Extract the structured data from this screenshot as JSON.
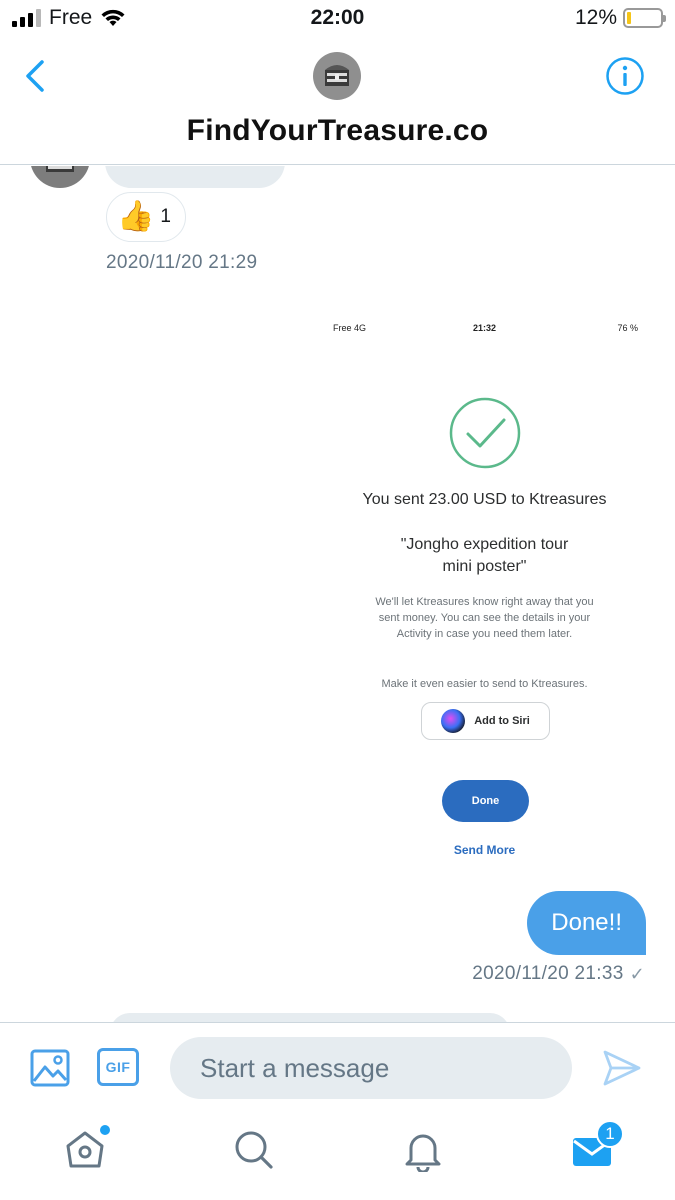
{
  "status_bar": {
    "carrier": "Free",
    "time": "22:00",
    "battery": "12%",
    "battery_level": 0.12
  },
  "header": {
    "title": "FindYourTreasure.co",
    "back_icon": "chevron-left-icon",
    "info_icon": "info-icon"
  },
  "messages": {
    "reaction_emoji": "👍",
    "reaction_count": "1",
    "timestamp_incoming": "2020/11/20 21:29",
    "outgoing_text": "Done!!",
    "timestamp_outgoing": "2020/11/20 21:33",
    "read_mark": "✓"
  },
  "receipt": {
    "status_left": "Free  4G",
    "status_time": "21:32",
    "status_right": "76 %",
    "sent_line": "You sent 23.00 USD to Ktreasures",
    "note_line1": "\"Jongho expedition tour",
    "note_line2": "mini poster\"",
    "body_line1": "We'll let Ktreasures know right away that you",
    "body_line2": "sent money. You can see the details in your",
    "body_line3": "Activity in case you need them later.",
    "easier_line": "Make it even easier to send to Ktreasures.",
    "siri_button": "Add to Siri",
    "done_button": "Done",
    "send_more": "Send More"
  },
  "composer": {
    "placeholder": "Start a message",
    "gif_label": "GIF",
    "image_icon": "image-icon",
    "send_icon": "send-icon"
  },
  "tabbar": {
    "dm_badge": "1",
    "icons": [
      "home-icon",
      "search-icon",
      "bell-icon",
      "mail-icon"
    ]
  },
  "colors": {
    "accent": "#4aa0e8",
    "bubble_incoming": "#e6ecf0",
    "paypal_blue": "#2b6cbf",
    "check_green": "#5bb98b"
  }
}
